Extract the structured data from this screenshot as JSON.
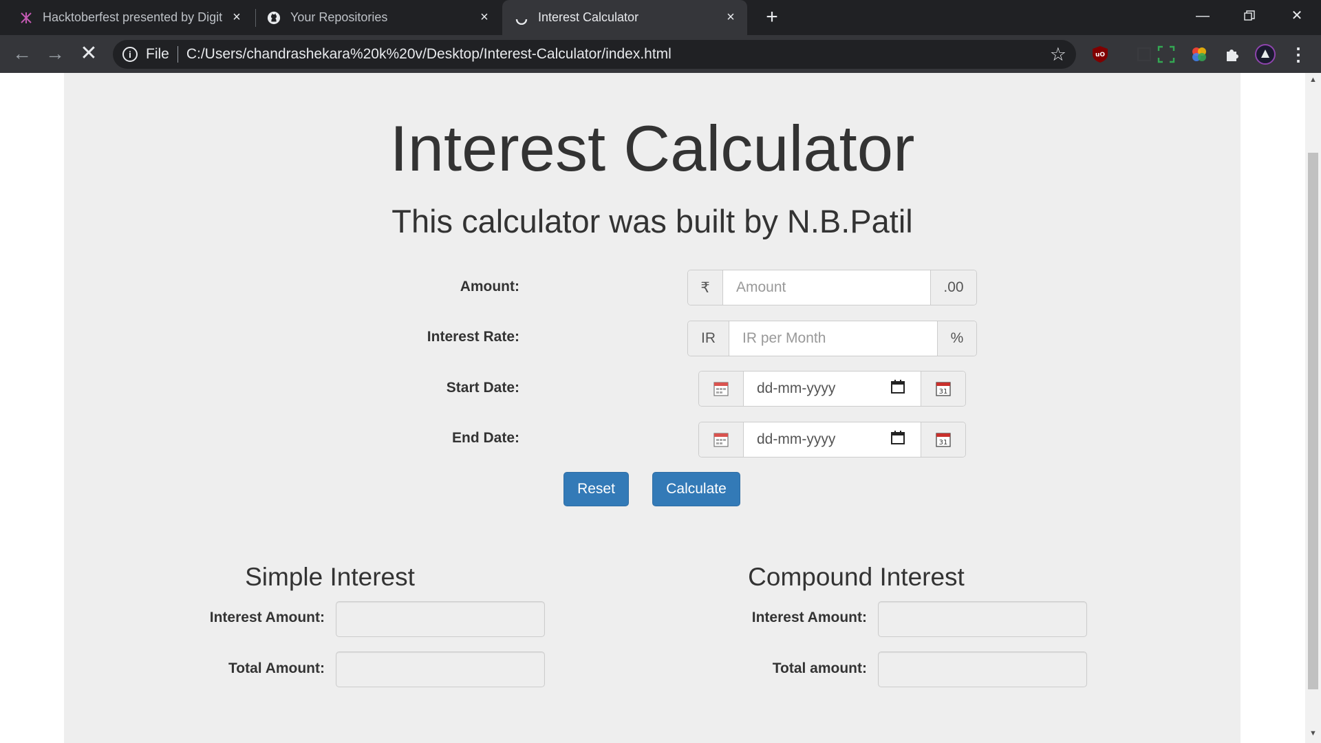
{
  "browser": {
    "tabs": [
      {
        "title": "Hacktoberfest presented by Digit",
        "icon": "hacktoberfest-icon"
      },
      {
        "title": "Your Repositories",
        "icon": "github-icon"
      },
      {
        "title": "Interest Calculator",
        "icon": "loading-spinner-icon"
      }
    ],
    "address": {
      "scheme_label": "File",
      "url": "C:/Users/chandrashekara%20k%20v/Desktop/Interest-Calculator/index.html"
    },
    "accent": "#337ab7"
  },
  "page": {
    "title": "Interest Calculator",
    "subtitle": "This calculator was built by N.B.Patil",
    "form": {
      "amount": {
        "label": "Amount:",
        "prefix": "₹",
        "placeholder": "Amount",
        "suffix": ".00"
      },
      "rate": {
        "label": "Interest Rate:",
        "prefix": "IR",
        "placeholder": "IR per Month",
        "suffix": "%"
      },
      "start_date": {
        "label": "Start Date:",
        "value": "dd-mm-yyyy"
      },
      "end_date": {
        "label": "End Date:",
        "value": "dd-mm-yyyy"
      }
    },
    "buttons": {
      "reset": "Reset",
      "calculate": "Calculate"
    },
    "simple": {
      "title": "Simple Interest",
      "interest_label": "Interest Amount:",
      "total_label": "Total Amount:"
    },
    "compound": {
      "title": "Compound Interest",
      "interest_label": "Interest Amount:",
      "total_label": "Total amount:"
    }
  }
}
